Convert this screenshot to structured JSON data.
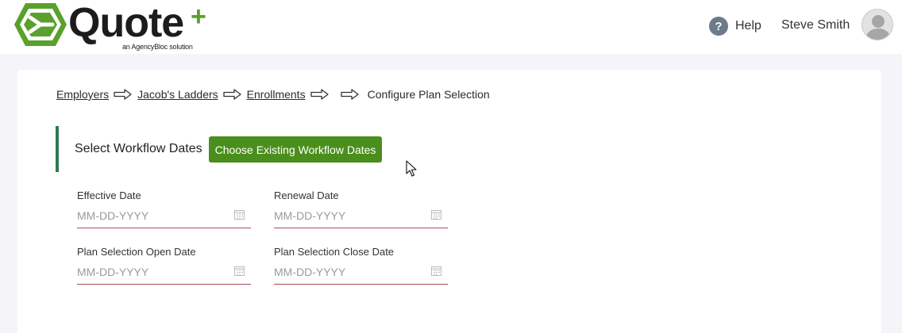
{
  "header": {
    "logo": {
      "word": "Quote",
      "plus": "+",
      "tagline": "an AgencyBloc solution"
    },
    "help_label": "Help",
    "help_icon": "question-circle-icon",
    "user_name": "Steve Smith",
    "avatar_icon": "user-avatar-icon"
  },
  "breadcrumb": {
    "items": [
      "Employers",
      "Jacob's Ladders",
      "Enrollments"
    ],
    "current": "Configure Plan Selection",
    "separator_icon": "right-arrow-icon"
  },
  "workflow": {
    "title": "Select Workflow Dates",
    "choose_button": "Choose Existing Workflow Dates",
    "fields": [
      {
        "label": "Effective Date",
        "placeholder": "MM-DD-YYYY",
        "value": ""
      },
      {
        "label": "Renewal Date",
        "placeholder": "MM-DD-YYYY",
        "value": ""
      },
      {
        "label": "Plan Selection Open Date",
        "placeholder": "MM-DD-YYYY",
        "value": ""
      },
      {
        "label": "Plan Selection Close Date",
        "placeholder": "MM-DD-YYYY",
        "value": ""
      }
    ]
  },
  "colors": {
    "brand_green": "#5aa02c",
    "button_green": "#4a8f1c",
    "section_accent": "#2c7a52",
    "input_underline": "#b04a5a",
    "page_background": "#f5f5f9"
  }
}
